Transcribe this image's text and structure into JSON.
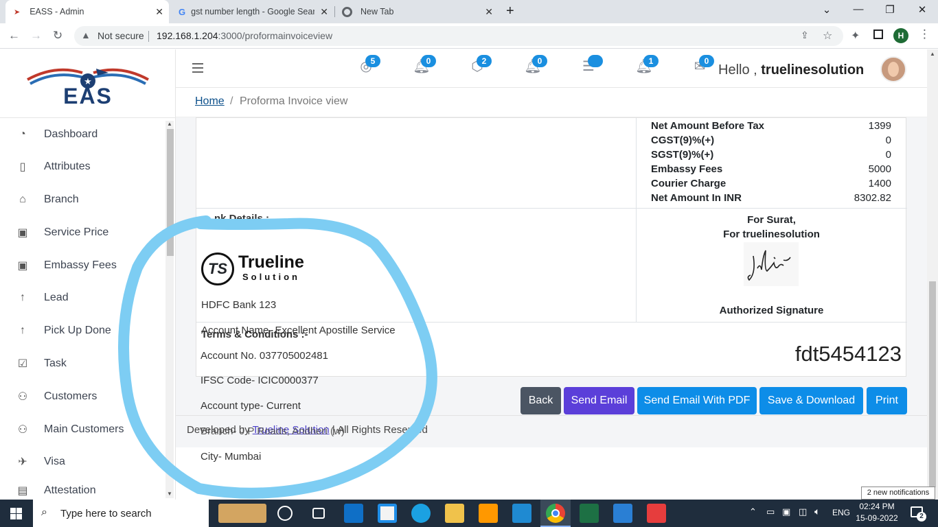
{
  "browser": {
    "tabs": [
      {
        "title": "EASS - Admin",
        "active": true
      },
      {
        "title": "gst number length - Google Sear",
        "active": false
      },
      {
        "title": "New Tab",
        "active": false
      }
    ],
    "security_label": "Not secure",
    "url_host": "192.168.1.204",
    "url_rest": ":3000/proformainvoiceview",
    "profile_initial": "H"
  },
  "app": {
    "logo_text": "EAS",
    "sidebar": {
      "items": [
        {
          "label": "Dashboard",
          "icon": "gauge-icon"
        },
        {
          "label": "Attributes",
          "icon": "book-icon"
        },
        {
          "label": "Branch",
          "icon": "bank-icon"
        },
        {
          "label": "Service Price",
          "icon": "money-icon"
        },
        {
          "label": "Embassy Fees",
          "icon": "money-icon"
        },
        {
          "label": "Lead",
          "icon": "arrow-up-icon"
        },
        {
          "label": "Pick Up Done",
          "icon": "arrow-up-icon"
        },
        {
          "label": "Task",
          "icon": "checkbox-icon"
        },
        {
          "label": "Customers",
          "icon": "users-icon"
        },
        {
          "label": "Main Customers",
          "icon": "users-icon"
        },
        {
          "label": "Visa",
          "icon": "plane-icon"
        },
        {
          "label": "Attestation",
          "icon": "document-icon"
        }
      ]
    },
    "header": {
      "badges": [
        "5",
        "0",
        "2",
        "0",
        "",
        "1",
        "0"
      ],
      "greeting": "Hello ,",
      "username": "truelinesolution"
    },
    "breadcrumb": {
      "home": "Home",
      "separator": "/",
      "current": "Proforma Invoice view"
    }
  },
  "invoice": {
    "summary": [
      {
        "label": "Net Amount Before Tax",
        "value": "1399"
      },
      {
        "label": "CGST(9)%(+)",
        "value": "0"
      },
      {
        "label": "SGST(9)%(+)",
        "value": "0"
      },
      {
        "label": "Embassy Fees",
        "value": "5000"
      },
      {
        "label": "Courier Charge",
        "value": "1400"
      },
      {
        "label": "Net Amount In INR",
        "value": "8302.82"
      }
    ],
    "bank_heading": "nk Details :",
    "company_logo_word1": "Trueline",
    "company_logo_word2": "Solution",
    "bank_name": "HDFC Bank 123",
    "account_name": "Account Name- Excellent Apostille Service",
    "terms_heading": "Terms & Conditions :-",
    "account_no": "Account No. 037705002481",
    "ifsc": "IFSC Code- ICIC0000377",
    "account_type": "Account type- Current",
    "branch": "Branch- J P Roads, Andheri (w)",
    "city": "City- Mumbai",
    "for_city": "For Surat,",
    "for_company": "For truelinesolution",
    "authorized": "Authorized Signature",
    "code": "fdt5454123"
  },
  "buttons": {
    "back": "Back",
    "send_email": "Send Email",
    "send_email_pdf": "Send Email With PDF",
    "save_download": "Save & Download",
    "print": "Print"
  },
  "footer": {
    "prefix": "Developed by",
    "link": "Trueline Solution",
    "suffix": "| All Rights Reserved"
  },
  "colors": {
    "back_btn": "#4b5563",
    "send_email_btn": "#5b3fd9",
    "primary_btn": "#0d8de8",
    "annotation": "#7dcdf3"
  },
  "taskbar": {
    "search_placeholder": "Type here to search",
    "lang": "ENG",
    "time": "02:24 PM",
    "date": "15-09-2022",
    "notif_count": "2",
    "notif_toast": "2 new notifications"
  }
}
